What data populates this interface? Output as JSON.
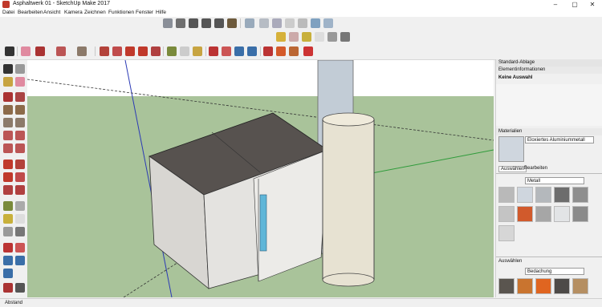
{
  "window": {
    "title": "Asphaltwerk 01 - SketchUp Make 2017"
  },
  "menu": [
    "Datei",
    "Bearbeiten",
    "Ansicht",
    "Kamera",
    "Zeichnen",
    "Funktionen",
    "Fenster",
    "Hilfe"
  ],
  "panel": {
    "tray_title": "Standard-Ablage",
    "entity_info": {
      "title": "Elementinformationen",
      "selection": "Keine Auswahl"
    },
    "materials": {
      "title": "Materialien",
      "current_material": "Eloxiertes Aluminiummetall",
      "tabs": [
        "Auswählen",
        "Bearbeiten"
      ],
      "library": "Metall",
      "section2_label": "Auswählen",
      "library2": "Bedachung"
    }
  },
  "status": {
    "measurements_label": "Abstand"
  },
  "colors": {
    "viewport_ground": "#a9c39a",
    "sky": "#ffffff",
    "roof": "#57524f",
    "wall": "#e4e3e0",
    "glass": "#5fb6d8"
  },
  "swatches_metal": [
    "#b9b9b9",
    "#cfd6de",
    "#b4b8bc",
    "#6d6d6d",
    "#8e8e8e",
    "#c4c4c4",
    "#d15a2c",
    "#a6a6a6",
    "#e2e4e6",
    "#8b8b8b",
    "#d6d6d6"
  ],
  "swatches_roof": [
    "#5a554f",
    "#c9742f",
    "#e06520",
    "#4d4a48",
    "#b58f62"
  ]
}
